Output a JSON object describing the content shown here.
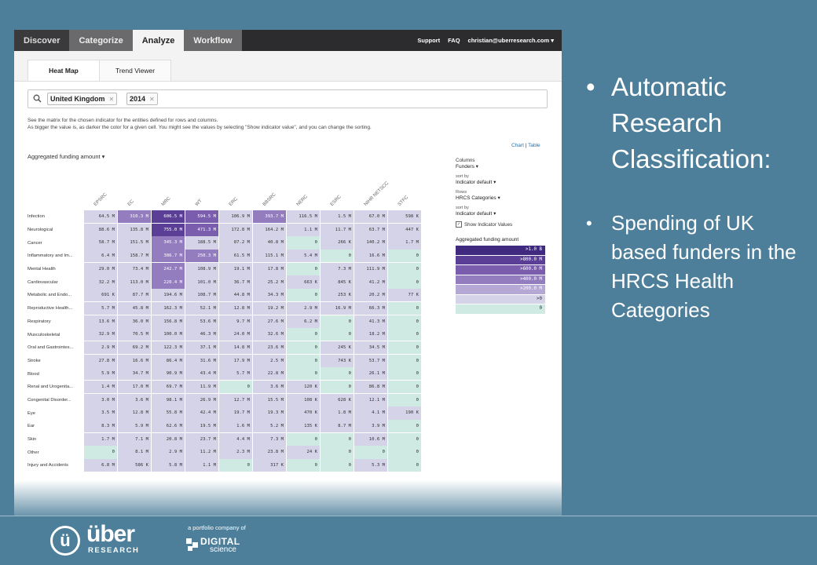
{
  "nav": {
    "tabs": [
      "Discover",
      "Categorize",
      "Analyze",
      "Workflow"
    ],
    "active": "Analyze",
    "support": "Support",
    "faq": "FAQ",
    "user": "christian@uberresearch.com"
  },
  "subtabs": [
    "Heat Map",
    "Trend Viewer"
  ],
  "search": {
    "chips": [
      "United Kingdom",
      "2014"
    ]
  },
  "description": [
    "See the matrix for the chosen indicator for the entities defined for rows and columns.",
    "As bigger the value is, as darker the color for a given cell. You might see the values by selecting \"Show indicator value\", and you can change the sorting."
  ],
  "view_links": {
    "chart": "Chart",
    "sep": "|",
    "table": "Table"
  },
  "indicator": "Aggregated funding amount",
  "columns": [
    "EPSRC",
    "EC",
    "MRC",
    "WT",
    "ERC",
    "BBSRC",
    "NERC",
    "ESRC",
    "NIHR NETSCC",
    "STFC"
  ],
  "rows": [
    {
      "label": "Infection",
      "values": [
        "64.5 M",
        "310.3 M",
        "606.5 M",
        "594.5 M",
        "106.9 M",
        "393.7 M",
        "116.5 M",
        "1.5 M",
        "67.0 M",
        "598 K"
      ],
      "levels": [
        1,
        2,
        4,
        3,
        1,
        2,
        1,
        1,
        1,
        1
      ]
    },
    {
      "label": "Neurological",
      "values": [
        "88.6 M",
        "135.8 M",
        "755.0 M",
        "471.3 M",
        "172.8 M",
        "164.2 M",
        "1.1 M",
        "11.7 M",
        "63.7 M",
        "447 K"
      ],
      "levels": [
        1,
        1,
        4,
        3,
        1,
        1,
        1,
        1,
        1,
        1
      ]
    },
    {
      "label": "Cancer",
      "values": [
        "58.7 M",
        "151.5 M",
        "345.3 M",
        "188.5 M",
        "87.2 M",
        "40.8 M",
        "0",
        "266 K",
        "140.2 M",
        "1.7 M"
      ],
      "levels": [
        1,
        1,
        2,
        1,
        1,
        1,
        0,
        1,
        1,
        1
      ]
    },
    {
      "label": "Inflammatory and Im...",
      "values": [
        "6.4 M",
        "158.7 M",
        "386.7 M",
        "250.3 M",
        "61.5 M",
        "115.1 M",
        "5.4 M",
        "0",
        "16.6 M",
        "0"
      ],
      "levels": [
        1,
        1,
        2,
        2,
        1,
        1,
        1,
        0,
        1,
        0
      ]
    },
    {
      "label": "Mental Health",
      "values": [
        "29.0 M",
        "73.4 M",
        "242.7 M",
        "108.9 M",
        "19.1 M",
        "17.8 M",
        "0",
        "7.3 M",
        "111.9 M",
        "0"
      ],
      "levels": [
        1,
        1,
        2,
        1,
        1,
        1,
        0,
        1,
        1,
        0
      ]
    },
    {
      "label": "Cardiovascular",
      "values": [
        "32.2 M",
        "113.0 M",
        "220.4 M",
        "101.0 M",
        "36.7 M",
        "25.2 M",
        "663 K",
        "845 K",
        "41.2 M",
        "0"
      ],
      "levels": [
        1,
        1,
        2,
        1,
        1,
        1,
        1,
        1,
        1,
        0
      ]
    },
    {
      "label": "Metabolic and Endo...",
      "values": [
        "691 K",
        "87.7 M",
        "194.6 M",
        "108.7 M",
        "44.8 M",
        "34.3 M",
        "0",
        "253 K",
        "20.2 M",
        "77 K"
      ],
      "levels": [
        1,
        1,
        1,
        1,
        1,
        1,
        0,
        1,
        1,
        1
      ]
    },
    {
      "label": "Reproductive Health...",
      "values": [
        "5.7 M",
        "45.8 M",
        "162.3 M",
        "52.1 M",
        "12.8 M",
        "19.2 M",
        "2.9 M",
        "16.9 M",
        "66.3 M",
        "0"
      ],
      "levels": [
        1,
        1,
        1,
        1,
        1,
        1,
        1,
        1,
        1,
        0
      ]
    },
    {
      "label": "Respiratory",
      "values": [
        "13.6 M",
        "36.0 M",
        "156.8 M",
        "53.6 M",
        "9.7 M",
        "27.6 M",
        "6.2 M",
        "0",
        "41.3 M",
        "0"
      ],
      "levels": [
        1,
        1,
        1,
        1,
        1,
        1,
        1,
        0,
        1,
        0
      ]
    },
    {
      "label": "Musculoskeletal",
      "values": [
        "32.9 M",
        "70.5 M",
        "100.0 M",
        "46.3 M",
        "24.0 M",
        "32.6 M",
        "0",
        "0",
        "18.2 M",
        "0"
      ],
      "levels": [
        1,
        1,
        1,
        1,
        1,
        1,
        0,
        0,
        1,
        0
      ]
    },
    {
      "label": "Oral and Gastrointes...",
      "values": [
        "2.9 M",
        "69.2 M",
        "122.3 M",
        "37.1 M",
        "14.8 M",
        "23.6 M",
        "0",
        "245 K",
        "34.5 M",
        "0"
      ],
      "levels": [
        1,
        1,
        1,
        1,
        1,
        1,
        0,
        1,
        1,
        0
      ]
    },
    {
      "label": "Stroke",
      "values": [
        "27.8 M",
        "16.6 M",
        "86.4 M",
        "31.6 M",
        "17.9 M",
        "2.5 M",
        "0",
        "743 K",
        "53.7 M",
        "0"
      ],
      "levels": [
        1,
        1,
        1,
        1,
        1,
        1,
        0,
        1,
        1,
        0
      ]
    },
    {
      "label": "Blood",
      "values": [
        "5.9 M",
        "34.7 M",
        "90.9 M",
        "43.4 M",
        "5.7 M",
        "22.8 M",
        "0",
        "0",
        "26.1 M",
        "0"
      ],
      "levels": [
        1,
        1,
        1,
        1,
        1,
        1,
        0,
        0,
        1,
        0
      ]
    },
    {
      "label": "Renal and Urogenita...",
      "values": [
        "1.4 M",
        "17.0 M",
        "69.7 M",
        "11.9 M",
        "0",
        "3.6 M",
        "120 K",
        "0",
        "86.8 M",
        "0"
      ],
      "levels": [
        1,
        1,
        1,
        1,
        0,
        1,
        1,
        0,
        1,
        0
      ]
    },
    {
      "label": "Congenital Disorder...",
      "values": [
        "3.0 M",
        "3.6 M",
        "98.1 M",
        "26.9 M",
        "12.7 M",
        "15.5 M",
        "108 K",
        "628 K",
        "12.1 M",
        "0"
      ],
      "levels": [
        1,
        1,
        1,
        1,
        1,
        1,
        1,
        1,
        1,
        0
      ]
    },
    {
      "label": "Eye",
      "values": [
        "3.5 M",
        "12.8 M",
        "55.8 M",
        "42.4 M",
        "19.7 M",
        "19.3 M",
        "470 K",
        "1.8 M",
        "4.1 M",
        "190 K"
      ],
      "levels": [
        1,
        1,
        1,
        1,
        1,
        1,
        1,
        1,
        1,
        1
      ]
    },
    {
      "label": "Ear",
      "values": [
        "8.3 M",
        "5.9 M",
        "62.6 M",
        "19.5 M",
        "1.6 M",
        "5.2 M",
        "135 K",
        "8.7 M",
        "3.9 M",
        "0"
      ],
      "levels": [
        1,
        1,
        1,
        1,
        1,
        1,
        1,
        1,
        1,
        0
      ]
    },
    {
      "label": "Skin",
      "values": [
        "1.7 M",
        "7.1 M",
        "20.8 M",
        "23.7 M",
        "4.4 M",
        "7.3 M",
        "0",
        "0",
        "10.6 M",
        "0"
      ],
      "levels": [
        1,
        1,
        1,
        1,
        1,
        1,
        0,
        0,
        1,
        0
      ]
    },
    {
      "label": "Other",
      "values": [
        "0",
        "8.1 M",
        "2.9 M",
        "11.2 M",
        "2.3 M",
        "23.8 M",
        "24 K",
        "0",
        "0",
        "0"
      ],
      "levels": [
        0,
        1,
        1,
        1,
        1,
        1,
        1,
        0,
        0,
        0
      ]
    },
    {
      "label": "Injury and Accidents",
      "values": [
        "6.8 M",
        "586 K",
        "5.8 M",
        "1.1 M",
        "0",
        "317 K",
        "0",
        "0",
        "5.3 M",
        "0"
      ],
      "levels": [
        1,
        1,
        1,
        1,
        0,
        1,
        0,
        0,
        1,
        0
      ]
    }
  ],
  "controls": {
    "columns_label": "Columns",
    "columns_value": "Funders",
    "sort1_label": "sort by",
    "sort1_value": "Indicator default",
    "rows_label": "Rows",
    "rows_value": "HRCS Categories",
    "sort2_label": "sort by",
    "sort2_value": "Indicator default",
    "show_values": "Show Indicator Values"
  },
  "legend": {
    "title": "Aggregated funding amount",
    "items": [
      ">1.0 B",
      ">800.0 M",
      ">600.0 M",
      ">400.0 M",
      ">200.0 M",
      ">0",
      "0"
    ],
    "colors": [
      "#3f2a80",
      "#5b3f96",
      "#7a5ead",
      "#947dbf",
      "#b5a8d4",
      "#d4d3e7",
      "#cfe9e3"
    ]
  },
  "bullets": {
    "b1": "Automatic Research Classification:",
    "b2": "Spending of UK based funders in the HRCS Health Categories",
    "dot": "•"
  },
  "footer": {
    "logo_mark": "ü",
    "logo_word": "über",
    "logo_sub": "RESEARCH",
    "portfolio": "a portfolio company of",
    "ds_digital": "DIGITAL",
    "ds_science": "science"
  }
}
